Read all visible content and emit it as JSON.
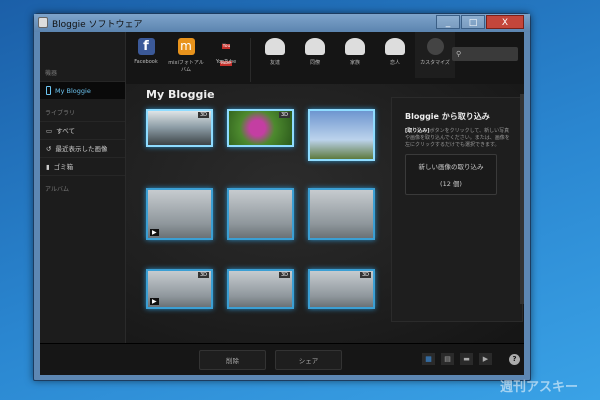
{
  "window": {
    "title": "Bloggie ソフトウェア",
    "minimize": "_",
    "maximize": "□",
    "close": "X"
  },
  "sidebar": {
    "device_header": "機器",
    "device_item": "My Bloggie",
    "library_header": "ライブラリ",
    "library_items": [
      {
        "label": "すべて",
        "icon": "▭"
      },
      {
        "label": "最近表示した画像",
        "icon": "↺"
      },
      {
        "label": "ゴミ箱",
        "icon": "▮"
      }
    ],
    "album_header": "アルバム"
  },
  "toolbar": {
    "items": [
      {
        "label": "Facebook",
        "icon": "f",
        "color": "#3b5998"
      },
      {
        "label": "mixiフォトアルバム",
        "icon": "m",
        "color": "#e8931c"
      },
      {
        "label": "YouTube",
        "icon": "You Tube",
        "color": "#c4302b"
      },
      {
        "label": "友達",
        "icon": "people"
      },
      {
        "label": "同僚",
        "icon": "people"
      },
      {
        "label": "家族",
        "icon": "people"
      },
      {
        "label": "恋人",
        "icon": "people"
      },
      {
        "label": "カスタマイズ",
        "icon": "wrench"
      }
    ],
    "search_icon": "⚲"
  },
  "main": {
    "title": "My Bloggie",
    "badge_3d": "3D",
    "play": "▶"
  },
  "import_panel": {
    "title": "Bloggie から取り込み",
    "text_bold": "[取り込み]",
    "text": "ボタンをクリックして、新しい写真や画像を取り込んでください。または、画像を左にクリックするだけでも選択できます。",
    "button_label": "新しい画像の取り込み",
    "button_count": "(12 個)"
  },
  "bottom": {
    "delete": "削除",
    "share": "シェア",
    "help": "?"
  },
  "watermark": "週刊アスキー"
}
